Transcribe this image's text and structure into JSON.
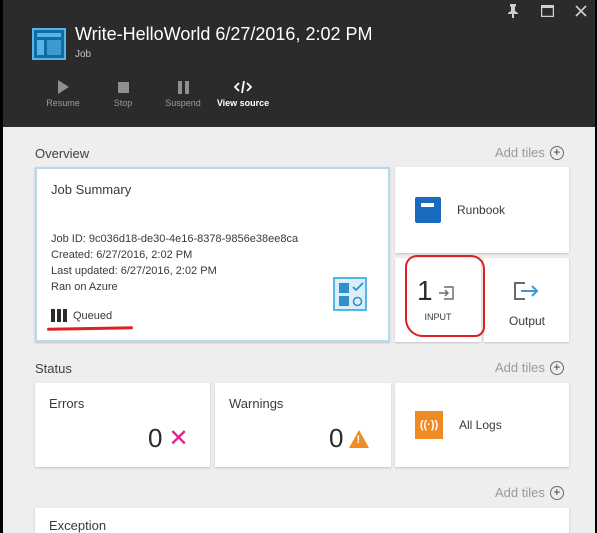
{
  "header": {
    "title": "Write-HelloWorld 6/27/2016, 2:02 PM",
    "subtitle": "Job",
    "controls": {
      "pin": "pin-icon",
      "maximize": "maximize-icon",
      "close": "close-icon"
    },
    "toolbar": [
      {
        "label": "Resume",
        "icon": "play-icon",
        "active": false
      },
      {
        "label": "Stop",
        "icon": "stop-icon",
        "active": false
      },
      {
        "label": "Suspend",
        "icon": "pause-icon",
        "active": false
      },
      {
        "label": "View source",
        "icon": "code-icon",
        "active": true
      }
    ]
  },
  "overview": {
    "label": "Overview",
    "add_tiles": "Add tiles",
    "job_summary": {
      "title": "Job Summary",
      "lines": [
        "Job ID: 9c036d18-de30-4e16-8378-9856e38ee8ca",
        "Created: 6/27/2016, 2:02 PM",
        "Last updated: 6/27/2016, 2:02 PM",
        "Ran on Azure"
      ],
      "status": "Queued"
    },
    "runbook": {
      "label": "Runbook"
    },
    "input": {
      "count": "1",
      "label": "INPUT"
    },
    "output": {
      "label": "Output"
    }
  },
  "status": {
    "label": "Status",
    "add_tiles": "Add tiles",
    "errors": {
      "title": "Errors",
      "count": "0"
    },
    "warnings": {
      "title": "Warnings",
      "count": "0"
    },
    "all_logs": {
      "label": "All Logs"
    }
  },
  "bottom": {
    "add_tiles": "Add tiles",
    "partial_title": "Exception"
  },
  "colors": {
    "accent": "#55b5e6",
    "header_bg": "#2b2b2b",
    "annotation": "#e02020",
    "error": "#e0208c",
    "warning": "#f08a24",
    "runbook": "#1a6bbf"
  }
}
